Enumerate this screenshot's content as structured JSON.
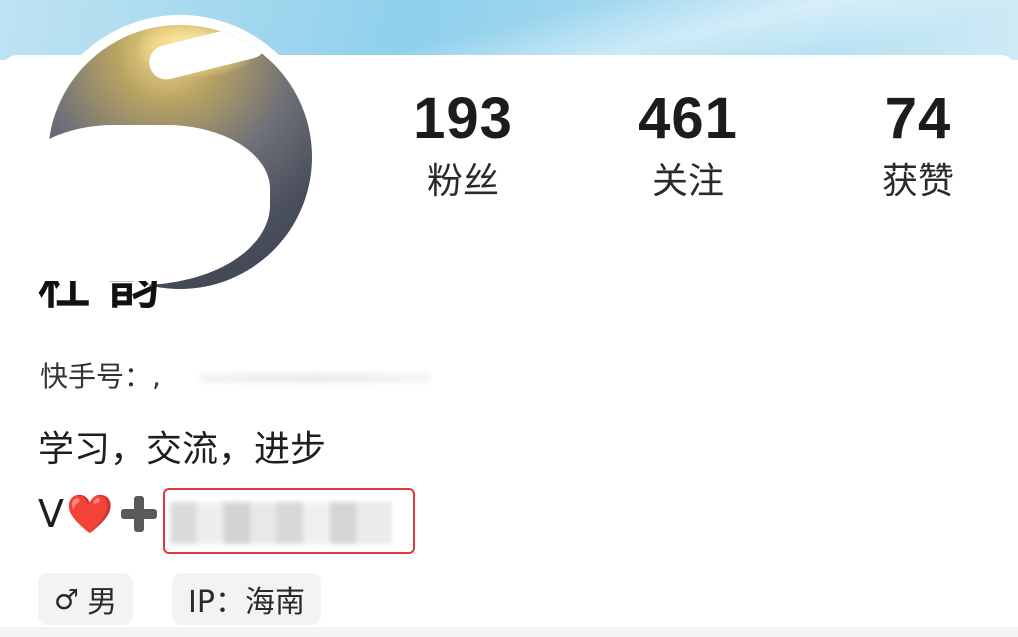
{
  "profile": {
    "stats": [
      {
        "value": "193",
        "label": "粉丝"
      },
      {
        "value": "461",
        "label": "关注"
      },
      {
        "value": "74",
        "label": "获赞"
      }
    ],
    "name_partial": "杜 韵",
    "handle_label": "快手号：,",
    "bio_line1": "学习，交流，进步",
    "bio_line2_prefix": "V",
    "bio_line2_heart": "❤️",
    "tags": [
      {
        "icon": "♂",
        "label": "男"
      },
      {
        "label": "IP：海南"
      }
    ]
  },
  "colors": {
    "banner": "#8fd0ec",
    "highlight_box": "#e0373b",
    "tag_bg": "#f3f3f5"
  }
}
